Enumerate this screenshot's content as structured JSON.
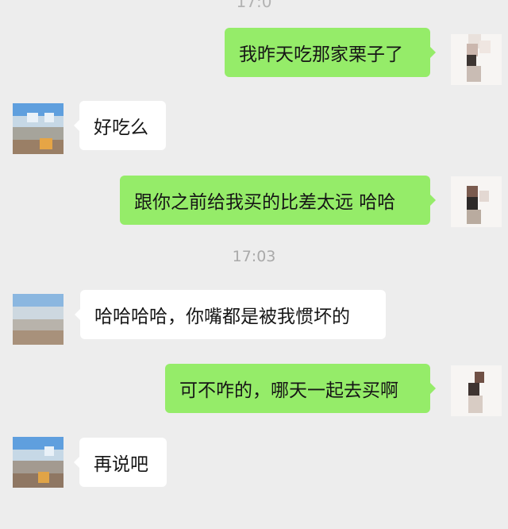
{
  "chat": {
    "top_time_partial": "17:0",
    "timestamp": "17:03",
    "messages": [
      {
        "side": "right",
        "text": "我昨天吃那家栗子了"
      },
      {
        "side": "left",
        "text": "好吃么"
      },
      {
        "side": "right",
        "text": "跟你之前给我买的比差太远 哈哈"
      },
      {
        "side": "left",
        "text": "哈哈哈哈，你嘴都是被我惯坏的"
      },
      {
        "side": "right",
        "text": "可不咋的，哪天一起去买啊"
      },
      {
        "side": "left",
        "text": "再说吧"
      }
    ]
  },
  "colors": {
    "background": "#ededed",
    "my_bubble": "#95ec69",
    "their_bubble": "#ffffff",
    "timestamp": "#a9a9a9"
  },
  "avatars": {
    "self": "pixelated-portrait-avatar",
    "contact": "pixelated-landscape-avatar"
  }
}
